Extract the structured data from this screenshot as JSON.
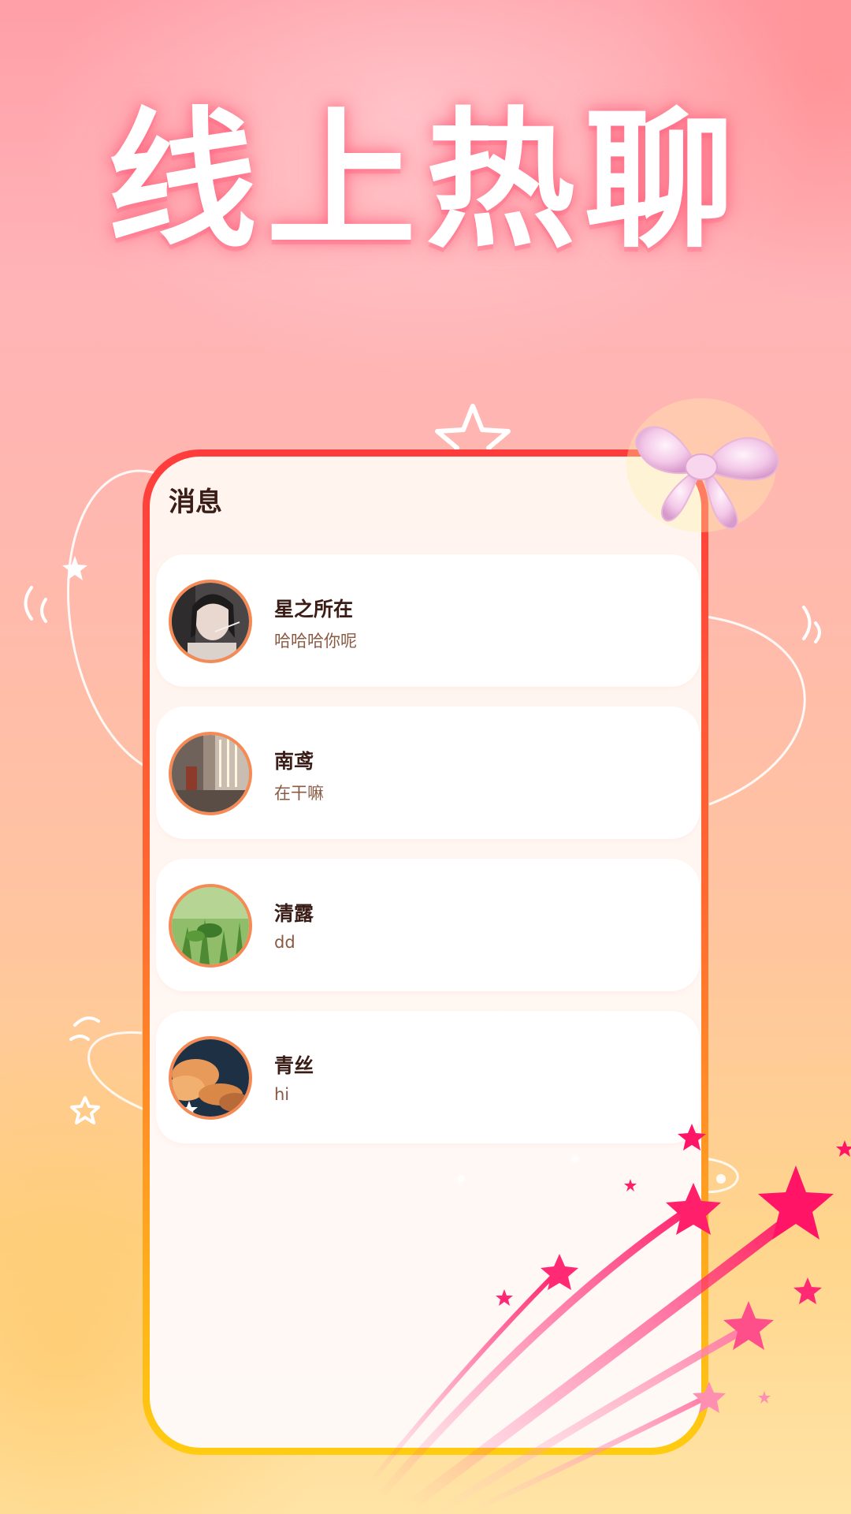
{
  "headline": "线上热聊",
  "screen": {
    "title": "消息"
  },
  "messages": [
    {
      "name": "星之所在",
      "preview": "哈哈哈你呢",
      "avatar": "portrait-photo"
    },
    {
      "name": "南鸢",
      "preview": "在干嘛",
      "avatar": "room-photo"
    },
    {
      "name": "清露",
      "preview": "dd",
      "avatar": "grass-photo"
    },
    {
      "name": "青丝",
      "preview": "hi",
      "avatar": "clouds-photo"
    }
  ],
  "colors": {
    "frame_top": "#ff3c3c",
    "frame_bottom": "#ffcc10",
    "avatar_ring": "#f58a55",
    "star": "#ff1f6b",
    "text_primary": "#3a1d16",
    "text_secondary": "#8a5a44"
  }
}
